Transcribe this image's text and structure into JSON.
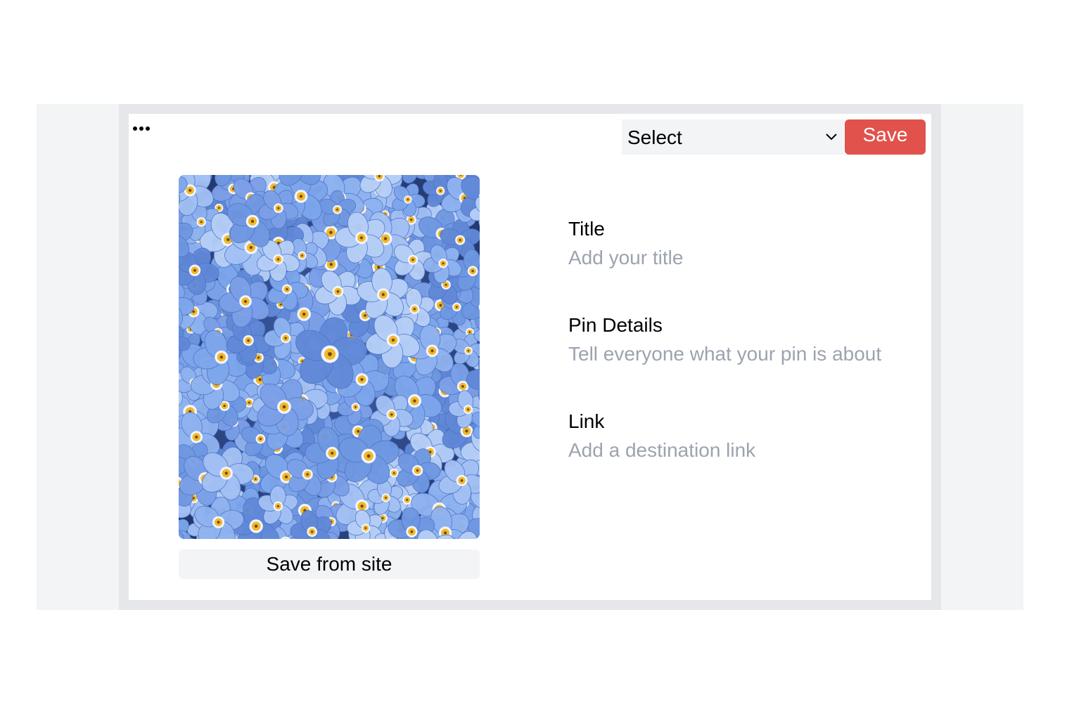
{
  "toolbar": {
    "more_icon": "ellipsis-icon",
    "board_select": {
      "selected": "Select",
      "icon": "chevron-down-icon"
    },
    "save_label": "Save",
    "save_color": "#e0524b"
  },
  "pin": {
    "image": "forget-me-not-flowers-photo",
    "save_from_site_label": "Save from site"
  },
  "form": {
    "title": {
      "label": "Title",
      "placeholder": "Add your title"
    },
    "details": {
      "label": "Pin Details",
      "placeholder": "Tell everyone what your pin is about"
    },
    "link": {
      "label": "Link",
      "placeholder": "Add a destination link"
    }
  }
}
